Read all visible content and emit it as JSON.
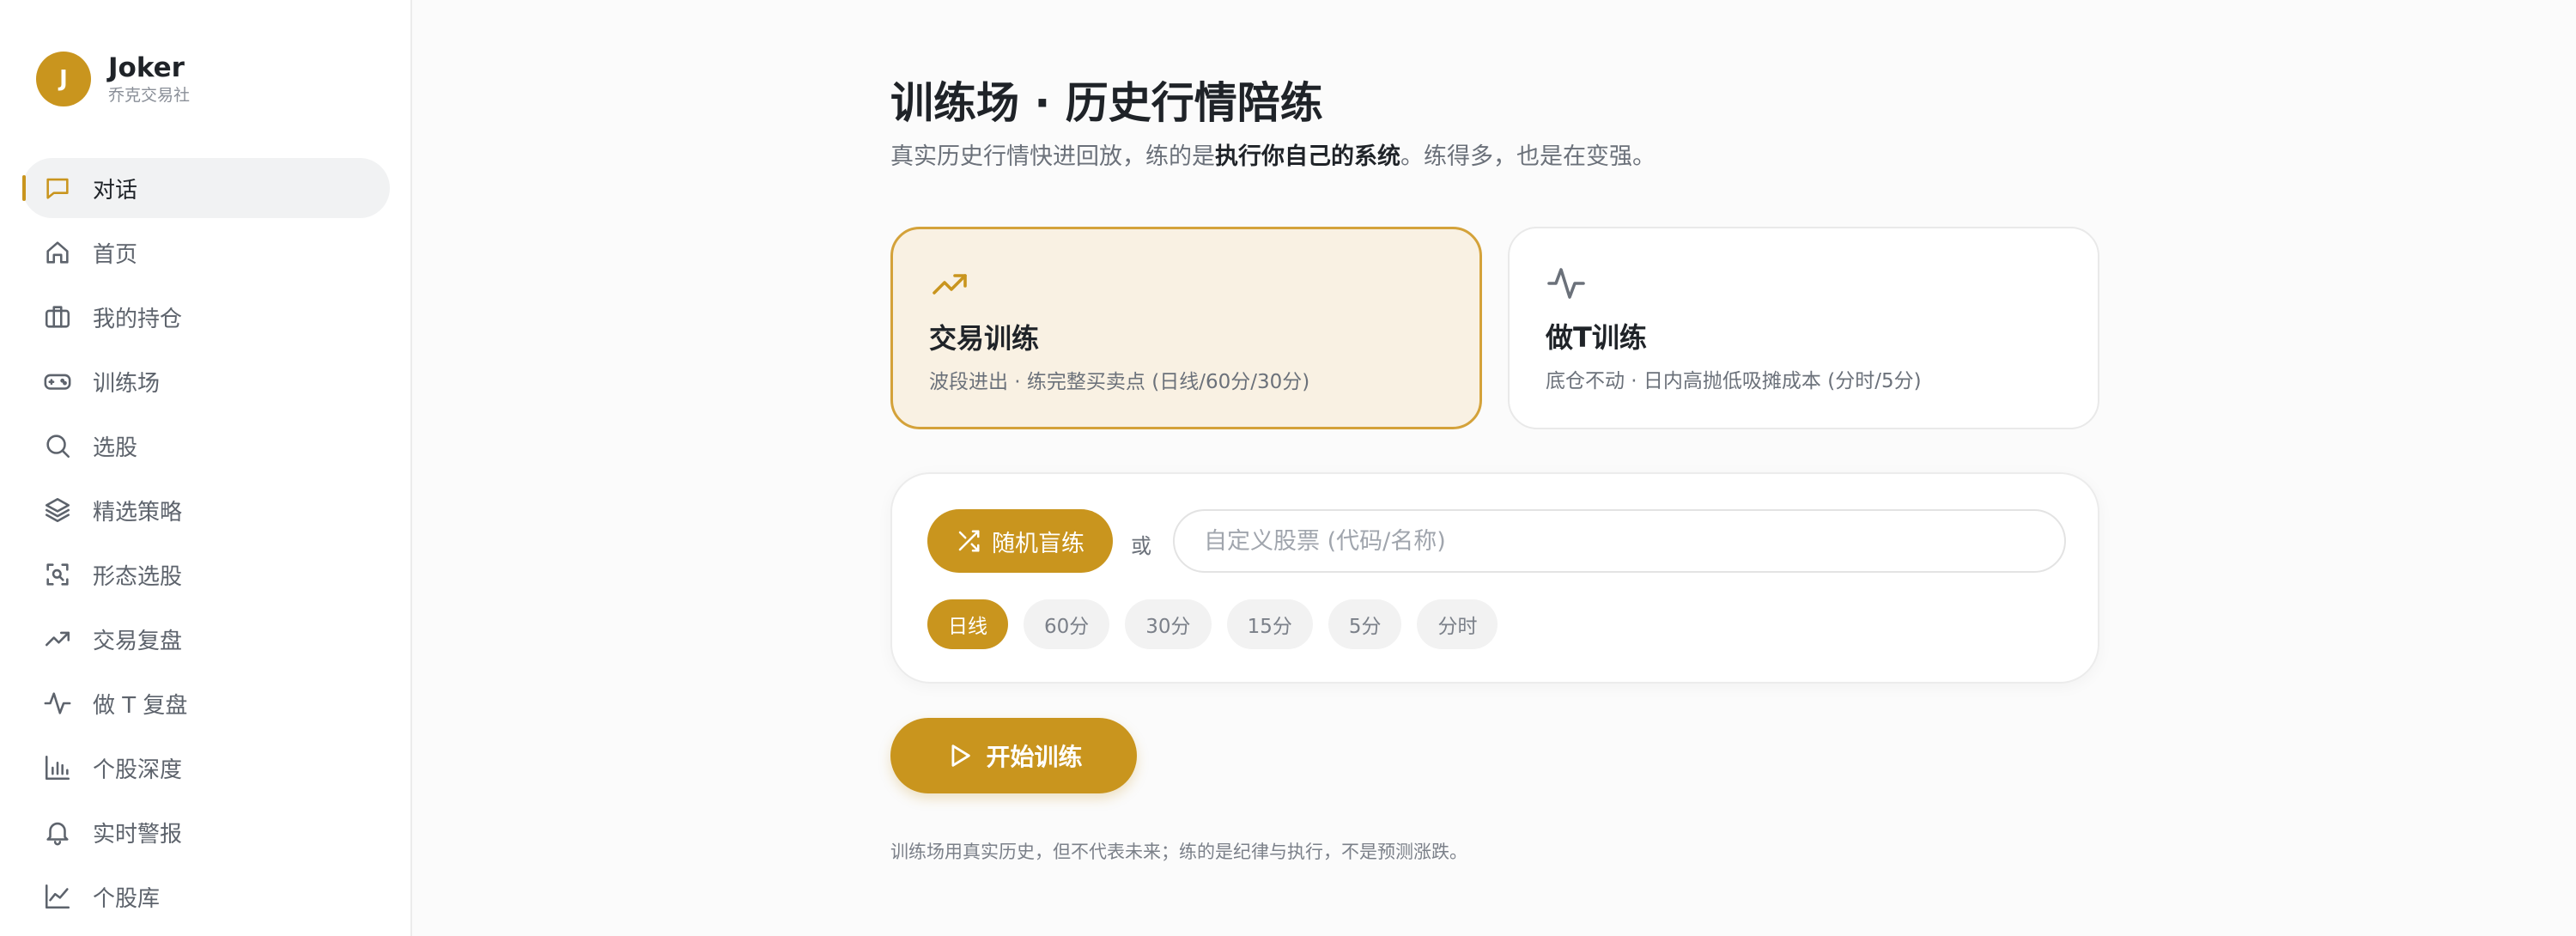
{
  "brand": {
    "initial": "J",
    "name": "Joker",
    "subtitle": "乔克交易社"
  },
  "sidebar": {
    "items": [
      {
        "label": "对话",
        "icon": "chat-icon",
        "active": true
      },
      {
        "label": "首页",
        "icon": "home-icon"
      },
      {
        "label": "我的持仓",
        "icon": "briefcase-icon"
      },
      {
        "label": "训练场",
        "icon": "gamepad-icon"
      },
      {
        "label": "选股",
        "icon": "search-icon"
      },
      {
        "label": "精选策略",
        "icon": "layers-icon"
      },
      {
        "label": "形态选股",
        "icon": "scan-icon"
      },
      {
        "label": "交易复盘",
        "icon": "trending-up-icon"
      },
      {
        "label": "做 T 复盘",
        "icon": "activity-icon"
      },
      {
        "label": "个股深度",
        "icon": "bar-chart-icon"
      },
      {
        "label": "实时警报",
        "icon": "bell-icon"
      },
      {
        "label": "个股库",
        "icon": "line-chart-icon"
      }
    ]
  },
  "main": {
    "title": "训练场 · 历史行情陪练",
    "subtitle_prefix": "真实历史行情快进回放，练的是",
    "subtitle_strong": "执行你自己的系统",
    "subtitle_suffix": "。练得多，也是在变强。",
    "modes": [
      {
        "title": "交易训练",
        "desc": "波段进出 · 练完整买卖点 (日线/60分/30分)",
        "icon": "trending-up-icon",
        "selected": true
      },
      {
        "title": "做T训练",
        "desc": "底仓不动 · 日内高抛低吸摊成本 (分时/5分)",
        "icon": "activity-icon",
        "selected": false
      }
    ],
    "random_button": "随机盲练",
    "or_label": "或",
    "stock_input": {
      "placeholder": "自定义股票 (代码/名称)",
      "value": ""
    },
    "timeframes": [
      {
        "label": "日线",
        "active": true
      },
      {
        "label": "60分"
      },
      {
        "label": "30分"
      },
      {
        "label": "15分"
      },
      {
        "label": "5分"
      },
      {
        "label": "分时"
      }
    ],
    "start_button": "开始训练",
    "footnote": "训练场用真实历史，但不代表未来；练的是纪律与执行，不是预测涨跌。"
  },
  "colors": {
    "accent": "#c9951e",
    "accent_bg": "#f9f1e3",
    "accent_border": "#d4a23a"
  }
}
